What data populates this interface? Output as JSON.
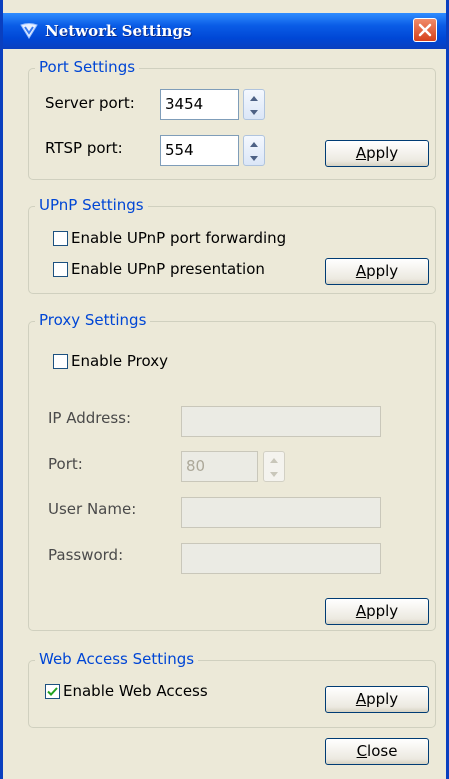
{
  "window": {
    "title": "Network Settings",
    "close_icon": "close-icon",
    "title_icon": "shield-icon"
  },
  "port_settings": {
    "legend": "Port Settings",
    "server_port_label": "Server port:",
    "server_port_value": "3454",
    "rtsp_port_label": "RTSP port:",
    "rtsp_port_value": "554",
    "apply_label": "Apply",
    "apply_accel": "A",
    "apply_rest": "pply"
  },
  "upnp_settings": {
    "legend": "UPnP Settings",
    "port_forwarding_label": "Enable UPnP port forwarding",
    "port_forwarding_checked": false,
    "presentation_label": "Enable UPnP presentation",
    "presentation_checked": false,
    "apply_accel": "A",
    "apply_rest": "pply"
  },
  "proxy_settings": {
    "legend": "Proxy Settings",
    "enable_label": "Enable Proxy",
    "enable_checked": false,
    "ip_label": "IP Address:",
    "ip_value": "",
    "port_label": "Port:",
    "port_value": "80",
    "username_label": "User Name:",
    "username_value": "",
    "password_label": "Password:",
    "password_value": "",
    "apply_accel": "A",
    "apply_rest": "pply"
  },
  "web_access_settings": {
    "legend": "Web Access Settings",
    "enable_label": "Enable Web Access",
    "enable_checked": true,
    "apply_accel": "A",
    "apply_rest": "pply"
  },
  "footer": {
    "close_accel": "C",
    "close_rest": "lose"
  },
  "colors": {
    "title_bar": "#0a5ce6",
    "legend_text": "#0046d5",
    "dialog_bg": "#ece9d8",
    "close_button": "#d6411c"
  }
}
